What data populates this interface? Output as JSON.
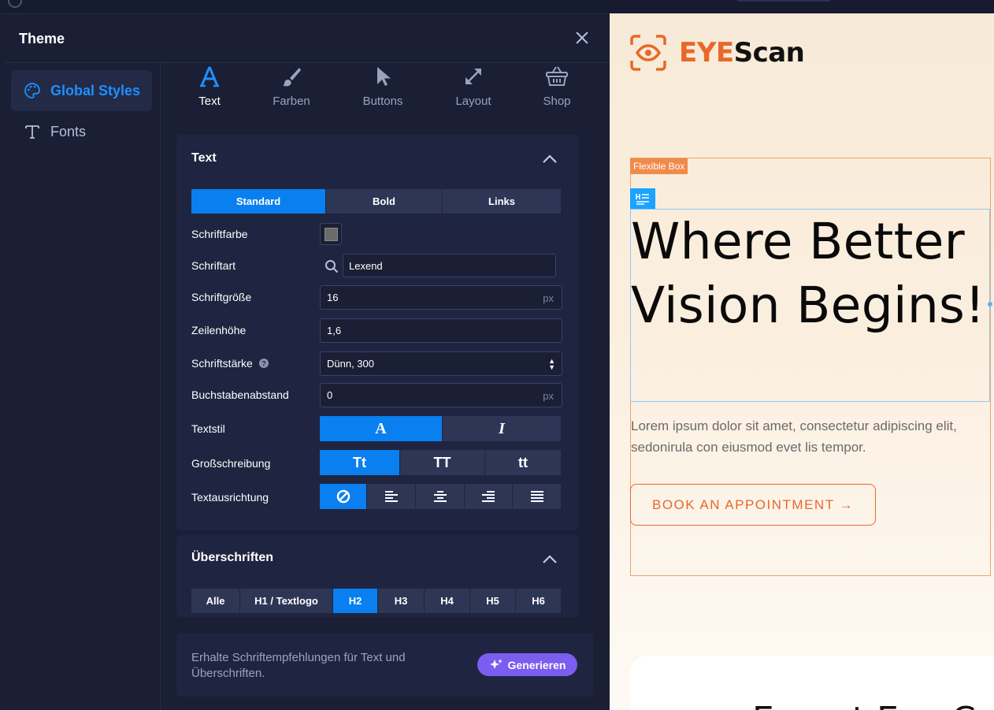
{
  "panel": {
    "title": "Theme"
  },
  "sidebar": {
    "items": [
      {
        "label": "Global Styles",
        "icon": "palette-icon",
        "active": true
      },
      {
        "label": "Fonts",
        "icon": "font-t-icon",
        "active": false
      }
    ]
  },
  "tabs": [
    {
      "label": "Text",
      "icon": "text-a-icon",
      "active": true
    },
    {
      "label": "Farben",
      "icon": "brush-icon",
      "active": false
    },
    {
      "label": "Buttons",
      "icon": "cursor-icon",
      "active": false
    },
    {
      "label": "Layout",
      "icon": "resize-arrows-icon",
      "active": false
    },
    {
      "label": "Shop",
      "icon": "basket-icon",
      "active": false
    }
  ],
  "text_card": {
    "title": "Text",
    "states": [
      "Standard",
      "Bold",
      "Links"
    ],
    "active_state": "Standard",
    "rows": {
      "color_label": "Schriftfarbe",
      "color_value": "#6b6b6b",
      "font_label": "Schriftart",
      "font_value": "Lexend",
      "size_label": "Schriftgröße",
      "size_value": "16",
      "size_unit": "px",
      "line_label": "Zeilenhöhe",
      "line_value": "1,6",
      "weight_label": "Schriftstärke",
      "weight_value": "Dünn, 300",
      "spacing_label": "Buchstabenabstand",
      "spacing_value": "0",
      "spacing_unit": "px",
      "style_label": "Textstil",
      "style_options": [
        "A",
        "I"
      ],
      "case_label": "Großschreibung",
      "case_options": [
        "Tt",
        "TT",
        "tt"
      ],
      "align_label": "Textausrichtung"
    }
  },
  "headings_card": {
    "title": "Überschriften",
    "options": [
      "Alle",
      "H1 / Textlogo",
      "H2",
      "H3",
      "H4",
      "H5",
      "H6"
    ],
    "active": "H2"
  },
  "suggest": {
    "text": "Erhalte Schriftempfehlungen für Text und Überschriften.",
    "button": "Generieren"
  },
  "preview": {
    "logo_eye": "EYE",
    "logo_scan": "Scan",
    "flex_tag": "Flexible Box",
    "hero_title": "Where Better Vision Begins!",
    "hero_sub": "Lorem ipsum dolor sit amet, consectetur adipiscing elit, sedonirula con eiusmod evet lis tempor.",
    "cta": "BOOK AN APPOINTMENT →",
    "peek_text": "Expert Eye C"
  },
  "colors": {
    "accent_blue": "#0a7ff0",
    "brand_orange": "#e8682a",
    "panel_bg": "#1a1f35",
    "generate_purple": "#7b5df0"
  }
}
